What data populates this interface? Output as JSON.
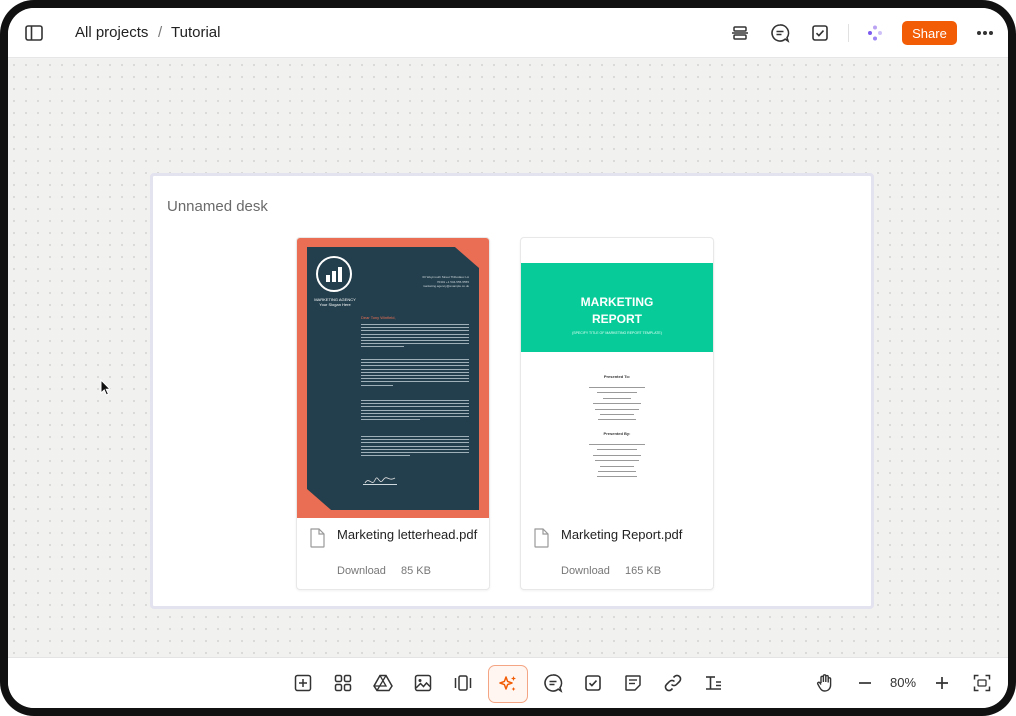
{
  "topbar": {
    "breadcrumb": {
      "project": "All projects",
      "separator": "/",
      "page": "Tutorial"
    },
    "share_label": "Share",
    "icons": [
      "sidebar-toggle-icon",
      "align-icon",
      "comment-icon",
      "checkbox-icon",
      "ai-dots-icon",
      "more-icon"
    ]
  },
  "desk": {
    "title": "Unnamed desk",
    "files": [
      {
        "name": "Marketing letterhead.pdf",
        "action": "Download",
        "size": "85 KB",
        "thumbnail": {
          "agency": "MARKETING AGENCY",
          "tagline": "Your Slogan Here",
          "address": "60 Weymouth Street Thibodaux LA 70301 +1 504-555-5555 marketing.agency@example.co.uk",
          "greeting": "Dear Tony Winfield,"
        }
      },
      {
        "name": "Marketing Report.pdf",
        "action": "Download",
        "size": "165 KB",
        "thumbnail": {
          "title_line1": "MARKETING",
          "title_line2": "REPORT",
          "subtitle": "(SPECIFY TITLE OF MARKETING REPORT TEMPLATE)",
          "presented_to": "Presented To:",
          "presented_by": "Presented By:"
        }
      }
    ]
  },
  "toolbar": {
    "zoom": "80%",
    "icons": [
      "add-frame-icon",
      "apps-icon",
      "drive-icon",
      "image-icon",
      "carousel-icon",
      "ai-sparkle-icon",
      "comment-icon",
      "checkbox-icon",
      "note-icon",
      "link-icon",
      "text-icon",
      "hand-icon",
      "zoom-out-icon",
      "zoom-in-icon",
      "fit-screen-icon"
    ]
  },
  "colors": {
    "accent": "#f25c05",
    "letterhead_bg": "#ea6e53",
    "letterhead_doc": "#233f4d",
    "report_band": "#07cc99"
  }
}
